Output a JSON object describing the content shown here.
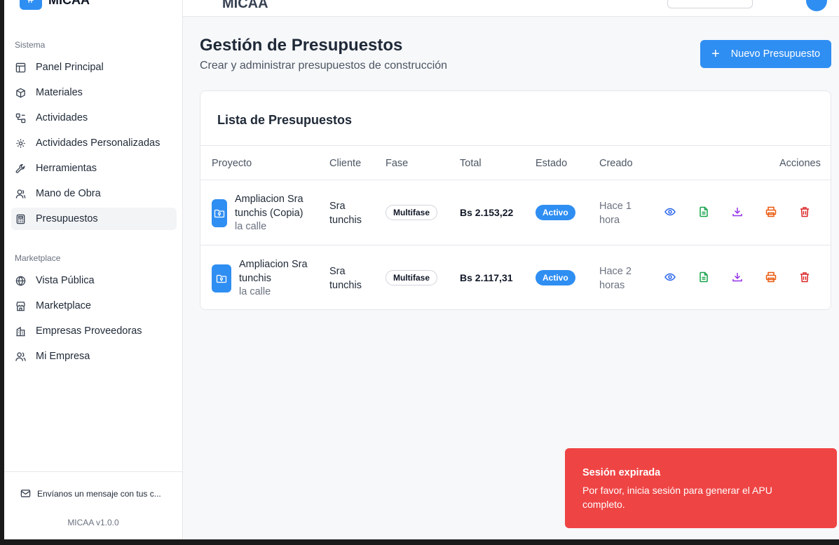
{
  "brand": {
    "name": "MICAA"
  },
  "header": {
    "title": "MICAA"
  },
  "sidebar": {
    "system_label": "Sistema",
    "system_items": [
      {
        "label": "Panel Principal",
        "icon": "layout-icon"
      },
      {
        "label": "Materiales",
        "icon": "package-icon"
      },
      {
        "label": "Actividades",
        "icon": "workflow-icon"
      },
      {
        "label": "Actividades Personalizadas",
        "icon": "gear-icon"
      },
      {
        "label": "Herramientas",
        "icon": "wrench-icon"
      },
      {
        "label": "Mano de Obra",
        "icon": "user-icon"
      },
      {
        "label": "Presupuestos",
        "icon": "calculator-icon",
        "active": true
      }
    ],
    "marketplace_label": "Marketplace",
    "marketplace_items": [
      {
        "label": "Vista Pública",
        "icon": "globe-icon"
      },
      {
        "label": "Marketplace",
        "icon": "store-icon"
      },
      {
        "label": "Empresas Proveedoras",
        "icon": "building-icon"
      },
      {
        "label": "Mi Empresa",
        "icon": "users-icon"
      }
    ],
    "feedback": "Envíanos un mensaje con tus c...",
    "version": "MICAA v1.0.0"
  },
  "main": {
    "title": "Gestión de Presupuestos",
    "subtitle": "Crear y administrar presupuestos de construcción",
    "new_button": "Nuevo Presupuesto",
    "card_title": "Lista de Presupuestos",
    "columns": [
      "Proyecto",
      "Cliente",
      "Fase",
      "Total",
      "Estado",
      "Creado",
      "Acciones"
    ],
    "rows": [
      {
        "project": "Ampliacion Sra tunchis (Copia)",
        "location": "la calle",
        "client": "Sra tunchis",
        "phase": "Multifase",
        "total": "Bs 2.153,22",
        "status": "Activo",
        "created": "Hace 1 hora"
      },
      {
        "project": "Ampliacion Sra tunchis",
        "location": "la calle",
        "client": "Sra tunchis",
        "phase": "Multifase",
        "total": "Bs 2.117,31",
        "status": "Activo",
        "created": "Hace 2 horas"
      }
    ]
  },
  "toast": {
    "title": "Sesión expirada",
    "message": "Por favor, inicia sesión para generar el APU completo.",
    "color": "#ef4444"
  },
  "colors": {
    "accent": "#2f8ef2",
    "view": "#2563eb",
    "doc": "#16a34a",
    "download": "#9333ea",
    "print": "#ea580c",
    "delete": "#dc2626"
  }
}
